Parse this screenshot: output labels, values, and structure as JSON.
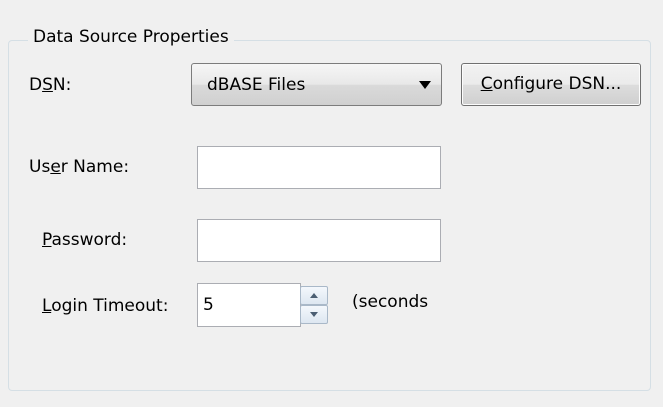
{
  "group": {
    "title": "Data Source Properties"
  },
  "dsn": {
    "label_pre": "D",
    "label_ul": "S",
    "label_post": "N:",
    "selected": "dBASE Files"
  },
  "configure_button": {
    "label_ul": "C",
    "label_rest": "onfigure DSN..."
  },
  "username": {
    "label_pre": "Us",
    "label_ul": "e",
    "label_post": "r Name:",
    "value": ""
  },
  "password": {
    "label_ul": "P",
    "label_post": "assword:",
    "value": ""
  },
  "timeout": {
    "label_ul": "L",
    "label_post": "ogin Timeout:",
    "value": "5",
    "unit": "(seconds"
  },
  "colors": {
    "background": "#f0f0f0",
    "border": "#d5dfe5",
    "input_border": "#abadb3"
  }
}
